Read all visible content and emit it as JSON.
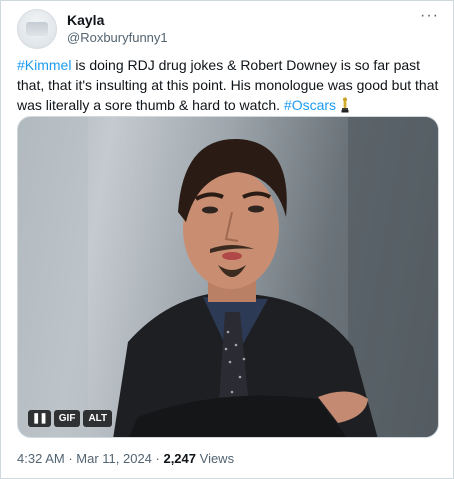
{
  "author": {
    "name": "Kayla",
    "handle": "@Roxburyfunny1"
  },
  "more_label": "···",
  "tweet": {
    "hashtag1": "#Kimmel",
    "text_part1": " is doing RDJ drug jokes & Robert Downey is so far past that, that it's insulting at this point. His monologue was good but that was literally a sore thumb & hard to watch. ",
    "hashtag2": "#Oscars",
    "emoji": "oscar-statuette-icon"
  },
  "media": {
    "type": "gif",
    "pause_label": "❚❚",
    "gif_label": "GIF",
    "alt_label": "ALT"
  },
  "meta": {
    "time": "4:32 AM",
    "separator": " · ",
    "date": "Mar 11, 2024",
    "views_count": "2,247",
    "views_label": " Views"
  }
}
